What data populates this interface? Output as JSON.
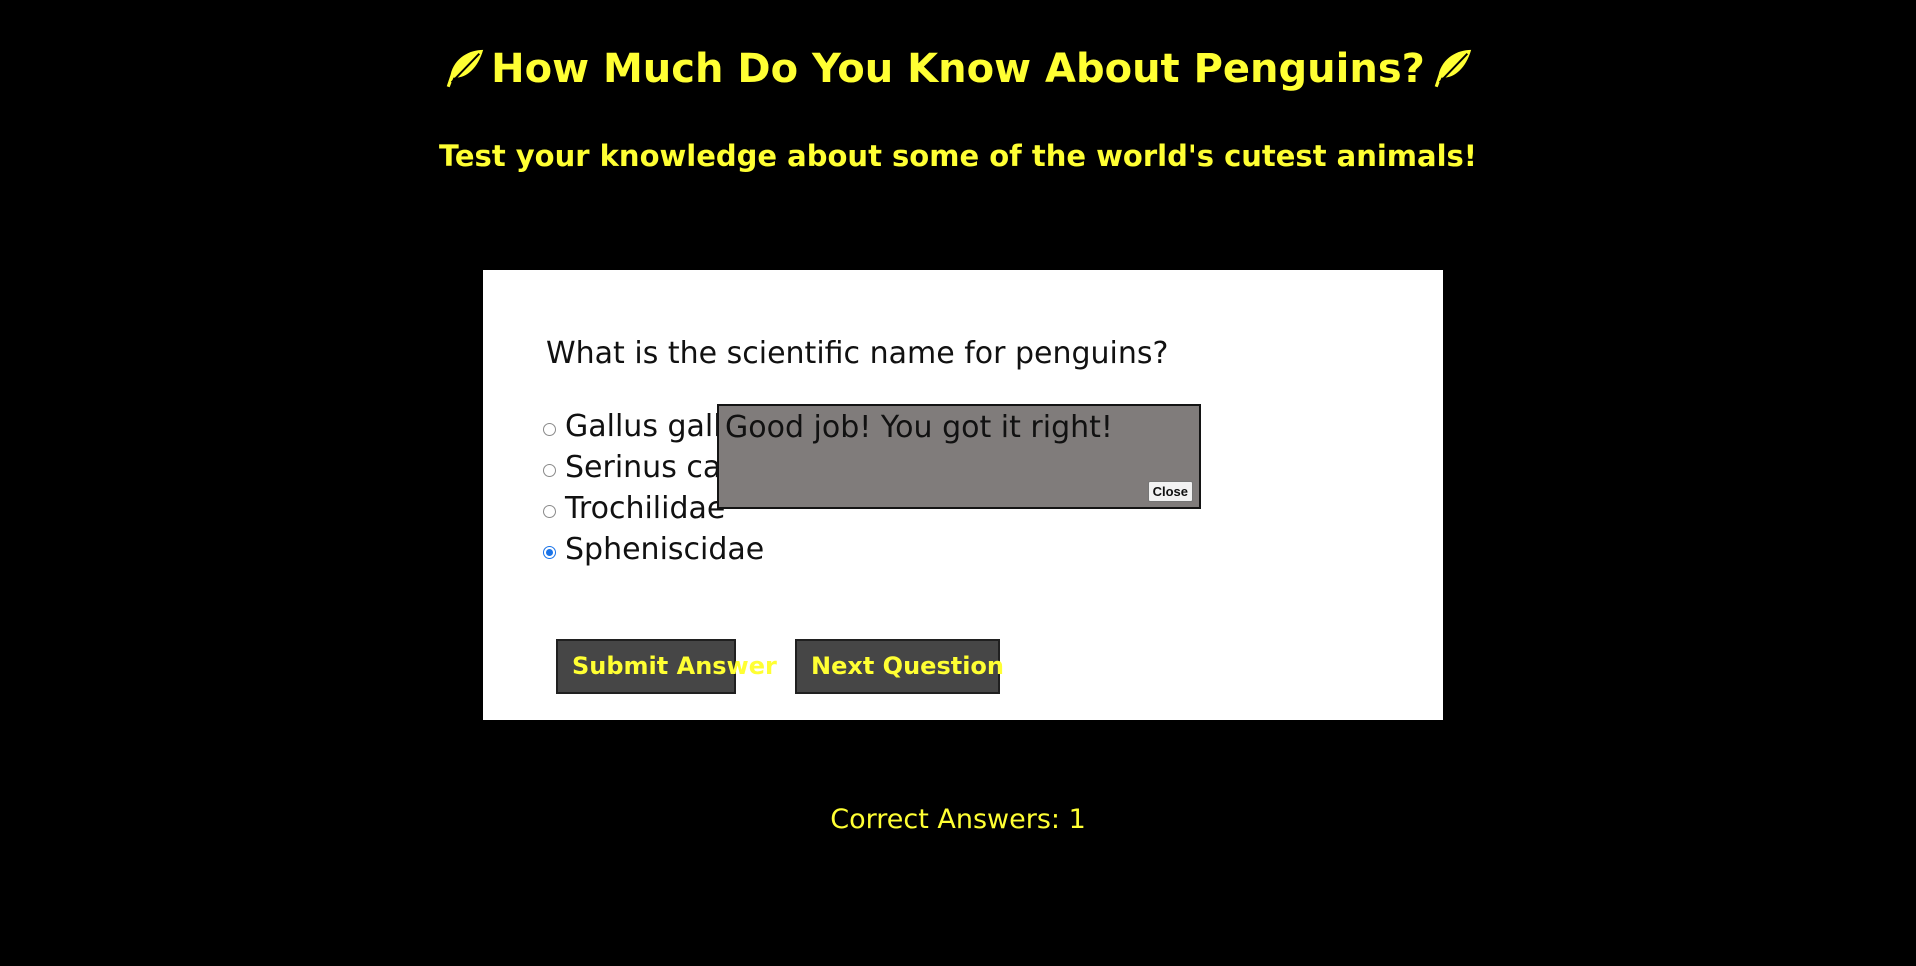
{
  "header": {
    "title": "How Much Do You Know About Penguins?",
    "subtitle": "Test your knowledge about some of the world's cutest animals!",
    "title_icon": "feather-icon"
  },
  "quiz": {
    "question": "What is the scientific name for penguins?",
    "options": [
      {
        "label": "Gallus gallus",
        "checked": false
      },
      {
        "label": "Serinus canaria",
        "checked": false
      },
      {
        "label": "Trochilidae",
        "checked": false
      },
      {
        "label": "Spheniscidae",
        "checked": true
      }
    ],
    "submit_label": "Submit Answer",
    "next_label": "Next Question"
  },
  "popup": {
    "message": "Good job! You got it right!",
    "close_label": "Close"
  },
  "score": {
    "text": "Correct Answers: 1"
  },
  "colors": {
    "background": "#000000",
    "accent": "#ffff33",
    "card": "#ffffff",
    "button": "#464646",
    "popup": "#807c7b",
    "radio_checked": "#1a73e8"
  }
}
